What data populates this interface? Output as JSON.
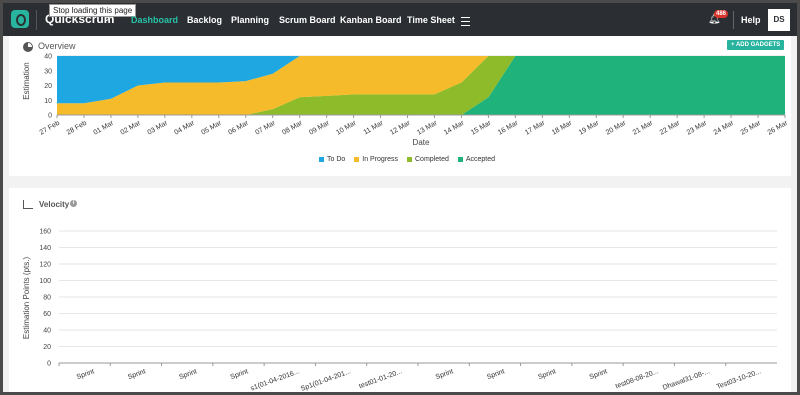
{
  "browser": {
    "tooltip": "Stop loading this page"
  },
  "app": {
    "brand": "Quickscrum"
  },
  "nav": [
    {
      "label": "Dashboard",
      "active": true
    },
    {
      "label": "Backlog"
    },
    {
      "label": "Planning"
    },
    {
      "label": "Scrum Board"
    },
    {
      "label": "Kanban Board"
    },
    {
      "label": "Time Sheet"
    }
  ],
  "header": {
    "notifications_count": "486",
    "help_label": "Help",
    "avatar_initials": "DS"
  },
  "overview": {
    "title": "Overview",
    "add_gadgets_label": "+ ADD GADGETS"
  },
  "velocity": {
    "title": "Velocity",
    "info": "i"
  },
  "colors": {
    "todo": "#1ea7e1",
    "inprogress": "#f5bb2a",
    "completed": "#8dbb2a",
    "accepted": "#1fb27a",
    "accent": "#27b39e",
    "nav_bg": "#2b2f33"
  },
  "chart_data": [
    {
      "type": "area",
      "title": "",
      "xlabel": "Date",
      "ylabel": "Estimation",
      "ylim": [
        0,
        40
      ],
      "yticks": [
        0,
        10,
        20,
        30,
        40
      ],
      "stacked": true,
      "grid": true,
      "legend_position": "bottom",
      "x": [
        "27 Feb",
        "28 Feb",
        "01 Mar",
        "02 Mar",
        "03 Mar",
        "04 Mar",
        "05 Mar",
        "06 Mar",
        "07 Mar",
        "08 Mar",
        "09 Mar",
        "10 Mar",
        "11 Mar",
        "12 Mar",
        "13 Mar",
        "14 Mar",
        "15 Mar",
        "16 Mar",
        "17 Mar",
        "18 Mar",
        "19 Mar",
        "20 Mar",
        "21 Mar",
        "22 Mar",
        "23 Mar",
        "24 Mar",
        "25 Mar",
        "26 Mar"
      ],
      "series": [
        {
          "name": "Accepted",
          "values": [
            0,
            0,
            0,
            0,
            0,
            0,
            0,
            0,
            0,
            0,
            0,
            0,
            0,
            0,
            0,
            0,
            12,
            40,
            40,
            40,
            40,
            40,
            40,
            40,
            40,
            40,
            40,
            40
          ]
        },
        {
          "name": "Completed",
          "values": [
            0,
            0,
            0,
            0,
            0,
            0,
            0,
            0,
            4,
            12,
            13,
            14,
            14,
            14,
            14,
            22,
            28,
            0,
            0,
            0,
            0,
            0,
            0,
            0,
            0,
            0,
            0,
            0
          ]
        },
        {
          "name": "In Progress",
          "values": [
            8,
            8,
            11,
            20,
            22,
            22,
            22,
            23,
            24,
            28,
            27,
            26,
            26,
            26,
            26,
            18,
            0,
            0,
            0,
            0,
            0,
            0,
            0,
            0,
            0,
            0,
            0,
            0
          ]
        },
        {
          "name": "To Do",
          "values": [
            32,
            32,
            29,
            20,
            18,
            18,
            18,
            17,
            12,
            0,
            0,
            0,
            0,
            0,
            0,
            0,
            0,
            0,
            0,
            0,
            0,
            0,
            0,
            0,
            0,
            0,
            0,
            0
          ]
        }
      ],
      "legend": [
        "To Do",
        "In Progress",
        "Completed",
        "Accepted"
      ]
    },
    {
      "type": "bar",
      "title": "",
      "xlabel": "",
      "ylabel": "Estimation Points (pts.)",
      "ylim": [
        0,
        160
      ],
      "yticks": [
        0,
        20,
        40,
        60,
        80,
        100,
        120,
        140,
        160
      ],
      "grid": true,
      "categories": [
        "Sprint",
        "Sprint",
        "Sprint",
        "Sprint",
        "s1(01-04-2016...",
        "Sp1(01-04-201...",
        "test01-01-20...",
        "Sprint",
        "Sprint",
        "Sprint",
        "Sprint",
        "test08-08-20...",
        "Dhawal31-08-...",
        "Test03-10-20..."
      ],
      "values": [
        0,
        0,
        0,
        0,
        0,
        0,
        0,
        0,
        0,
        0,
        0,
        0,
        0,
        0
      ]
    }
  ]
}
